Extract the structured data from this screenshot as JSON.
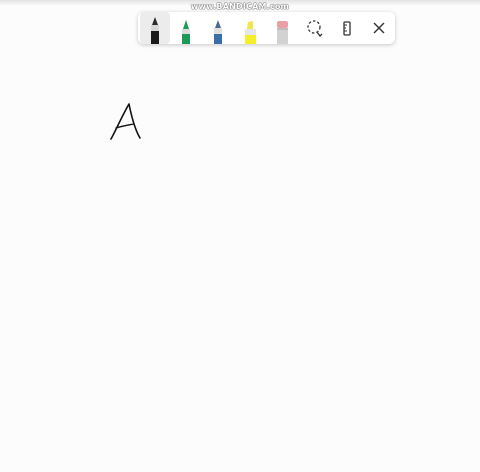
{
  "watermark": "www.BANDICAM.com",
  "toolbar": {
    "tools": [
      {
        "name": "ballpoint-pen",
        "color": "#1b1b1b",
        "selected": true
      },
      {
        "name": "pen",
        "color": "#1d9a57",
        "selected": false
      },
      {
        "name": "pencil",
        "color": "#3a6ea8",
        "selected": false
      },
      {
        "name": "highlighter",
        "color": "#f4ef2a",
        "selected": false
      },
      {
        "name": "eraser",
        "color": "#e8a0a4",
        "selected": false
      },
      {
        "name": "lasso-select-icon"
      },
      {
        "name": "ruler-icon"
      },
      {
        "name": "close-icon"
      }
    ]
  },
  "canvas": {
    "ink_strokes": "handwritten letter A"
  }
}
